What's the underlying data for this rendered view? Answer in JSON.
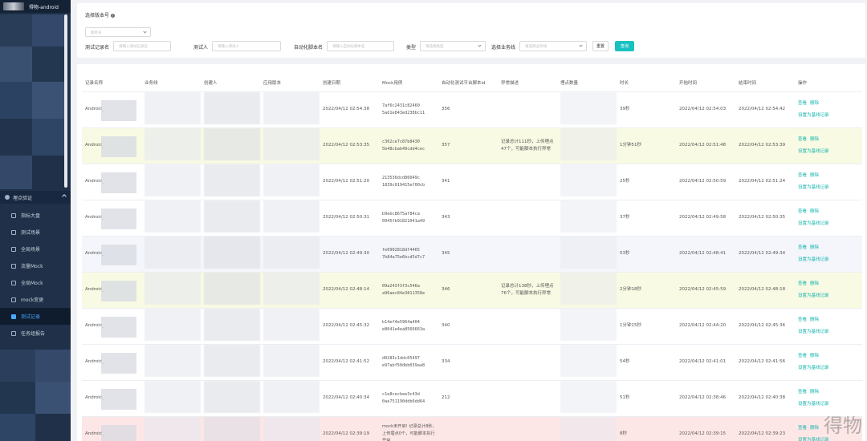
{
  "app": {
    "title": "得物-android"
  },
  "sidebar": {
    "group": "埋点验证",
    "items": [
      {
        "label": "指标大盘"
      },
      {
        "label": "测试场景"
      },
      {
        "label": "全局场景"
      },
      {
        "label": "流量Mock"
      },
      {
        "label": "全局Mock"
      },
      {
        "label": "mock变更"
      },
      {
        "label": "测试记录",
        "active": true
      },
      {
        "label": "任务组报告"
      }
    ]
  },
  "filters": {
    "title": "选择版本号",
    "version_placeholder": "版本号",
    "record_name_label": "测试记录名",
    "record_name_placeholder": "请输入测试记录名",
    "tester_label": "测试人",
    "tester_placeholder": "请输入测试人",
    "script_label": "自动化脚本名",
    "script_placeholder": "请输入自动化脚本名",
    "type_label": "类型",
    "type_placeholder": "请选择类型",
    "business_label": "选择业务线",
    "business_placeholder": "请选择业务线",
    "reset_label": "重置",
    "query_label": "查询"
  },
  "table": {
    "headers": [
      "记录名称",
      "业务线",
      "创建人",
      "应用版本",
      "创建日期",
      "Mock用例",
      "自动化测试平台脚本id",
      "异常描述",
      "埋点数量",
      "时长",
      "开始时间",
      "结束时间",
      "操作"
    ],
    "rows": [
      {
        "name": "Android_",
        "created": "2022/04/12 02:54:38",
        "mock": "7af6c2431c82460 5ad1e843ed238bc11",
        "script_id": "356",
        "error": "",
        "duration": "39秒",
        "start": "2022/04/12 02:54:03",
        "end": "2022/04/12 02:54:42"
      },
      {
        "name": "Android_",
        "created": "2022/04/12 02:53:35",
        "mock": "c362ce7c87b8430 5b48cbab49cdd4cec",
        "script_id": "357",
        "error": "记录总计111秒，上传埋点47个，可能脚本执行异常",
        "duration": "1分钟51秒",
        "start": "2022/04/12 02:51:48",
        "end": "2022/04/12 02:53:39"
      },
      {
        "name": "Android_",
        "created": "2022/04/12 02:51:20",
        "mock": "213536dcd86049c 1839c019415ef00cb",
        "script_id": "341",
        "error": "",
        "duration": "25秒",
        "start": "2022/04/12 02:50:59",
        "end": "2022/04/12 02:51:24"
      },
      {
        "name": "Android_",
        "created": "2022/04/12 02:50:31",
        "mock": "b9ebc8675af84ca 0945fb91821041a49",
        "script_id": "343",
        "error": "",
        "duration": "37秒",
        "start": "2022/04/12 02:49:58",
        "end": "2022/04/12 02:50:35"
      },
      {
        "name": "Android_",
        "created": "2022/04/12 02:49:30",
        "mock": "fe0902818df4465 7b84a75e6bcd5d7c7",
        "script_id": "345",
        "error": "",
        "duration": "53秒",
        "start": "2022/04/12 02:48:41",
        "end": "2022/04/12 02:49:34"
      },
      {
        "name": "Android_",
        "created": "2022/04/12 02:48:14",
        "mock": "09a243f3f3c546a a96aec84e3811358e",
        "script_id": "346",
        "error": "记录总计138秒，上传埋点76个，可能脚本执行异常",
        "duration": "2分钟18秒",
        "start": "2022/04/12 02:45:59",
        "end": "2022/04/12 02:48:18"
      },
      {
        "name": "Android_",
        "created": "2022/04/12 02:45:32",
        "mock": "b14ef4e5964a404 e8041e4ea8566663a",
        "script_id": "340",
        "error": "",
        "duration": "1分钟15秒",
        "start": "2022/04/12 02:44:20",
        "end": "2022/04/12 02:45:36"
      },
      {
        "name": "Android_",
        "created": "2022/04/12 02:41:52",
        "mock": "d0283c1ddc05497 e97abf50dbb039aa8",
        "script_id": "334",
        "error": "",
        "duration": "54秒",
        "start": "2022/04/12 02:41:01",
        "end": "2022/04/12 02:41:56"
      },
      {
        "name": "Android_",
        "created": "2022/04/12 02:40:34",
        "mock": "c1e8cecbee3c43d 0ae751190ddb6dd64",
        "script_id": "212",
        "error": "",
        "duration": "51秒",
        "start": "2022/04/12 02:38:46",
        "end": "2022/04/12 02:40:38"
      },
      {
        "name": "Android_",
        "created": "2022/04/12 02:39:19",
        "mock": "mock未开启! 记录总计8秒，上传埋点0个，可能脚本执行异常",
        "script_id": "",
        "error": "",
        "duration": "8秒",
        "start": "2022/04/12 02:39:15",
        "end": "2022/04/12 02:39:23"
      }
    ],
    "row_styles": [
      "white",
      "yellow",
      "white",
      "white",
      "blue",
      "yellow",
      "white",
      "white",
      "white",
      "red"
    ],
    "actions": {
      "view": "查看",
      "delete": "删除",
      "baseline": "设置为基线记录"
    }
  },
  "watermark": "得物"
}
